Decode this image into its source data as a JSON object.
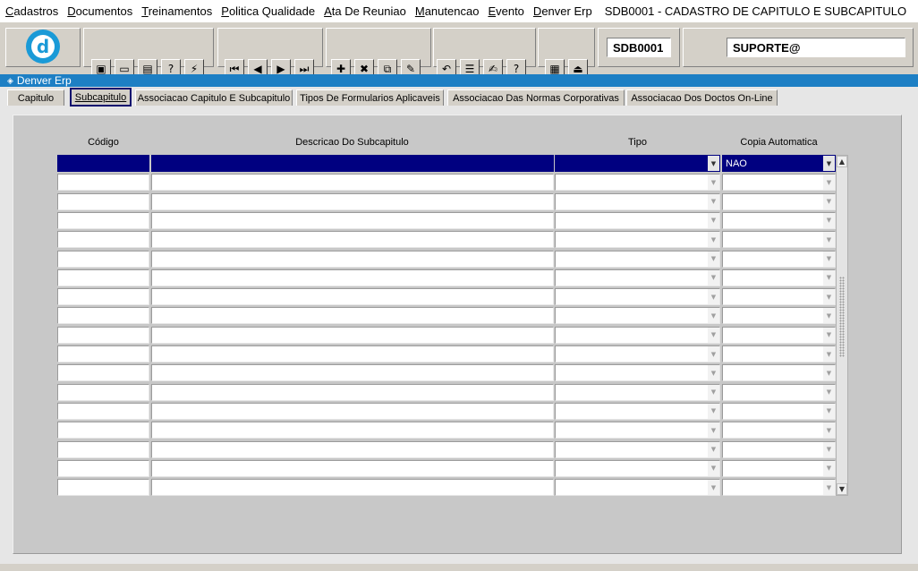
{
  "menu": {
    "items": [
      {
        "label": "Cadastros",
        "key": "C",
        "rest": "adastros"
      },
      {
        "label": "Documentos",
        "key": "D",
        "rest": "ocumentos"
      },
      {
        "label": "Treinamentos",
        "key": "T",
        "rest": "reinamentos"
      },
      {
        "label": "Politica Qualidade",
        "key": "P",
        "rest": "olitica Qualidade"
      },
      {
        "label": "Ata De Reuniao",
        "key": "A",
        "rest": "ta De Reuniao"
      },
      {
        "label": "Manutencao",
        "key": "M",
        "rest": "anutencao"
      },
      {
        "label": "Evento",
        "key": "E",
        "rest": "vento"
      },
      {
        "label": "Denver Erp",
        "key": "D",
        "rest": "enver Erp"
      }
    ],
    "window_title": "SDB0001 - CADASTRO DE CAPITULO E SUBCAPITULO"
  },
  "toolbar": {
    "logo_letter": "d",
    "form_code": "SDB0001",
    "user": "SUPORTE@",
    "buttons": [
      {
        "name": "save-button",
        "glyph": "▣"
      },
      {
        "name": "exit-form-button",
        "glyph": "▭"
      },
      {
        "name": "print-button",
        "glyph": "▤"
      },
      {
        "name": "enter-query-button",
        "glyph": "?"
      },
      {
        "name": "execute-query-button",
        "glyph": "⚡"
      },
      {
        "name": "first-record-button",
        "glyph": "⏮"
      },
      {
        "name": "previous-record-button",
        "glyph": "◀"
      },
      {
        "name": "next-record-button",
        "glyph": "▶"
      },
      {
        "name": "last-record-button",
        "glyph": "⏭"
      },
      {
        "name": "insert-record-button",
        "glyph": "✚"
      },
      {
        "name": "delete-record-button",
        "glyph": "✖"
      },
      {
        "name": "duplicate-record-button",
        "glyph": "⧉"
      },
      {
        "name": "clear-record-button",
        "glyph": "✎"
      },
      {
        "name": "undo-button",
        "glyph": "↶"
      },
      {
        "name": "list-values-button",
        "glyph": "☰"
      },
      {
        "name": "edit-field-button",
        "glyph": "✍"
      },
      {
        "name": "help-button",
        "glyph": "?"
      },
      {
        "name": "menu-button",
        "glyph": "▦"
      },
      {
        "name": "exit-button",
        "glyph": "⏏"
      }
    ]
  },
  "window": {
    "title": "Denver Erp"
  },
  "tabs": [
    {
      "label": "Capitulo",
      "active": false
    },
    {
      "label": "Subcapitulo",
      "active": true
    },
    {
      "label": "Associacao Capitulo E Subcapitulo",
      "active": false
    },
    {
      "label": "Tipos De Formularios Aplicaveis",
      "active": false
    },
    {
      "label": "Associacao Das Normas Corporativas",
      "active": false
    },
    {
      "label": "Associacao Dos Doctos On-Line",
      "active": false
    }
  ],
  "grid": {
    "headers": {
      "codigo": "Código",
      "descricao": "Descricao Do Subcapitulo",
      "tipo": "Tipo",
      "copia": "Copia Automatica"
    },
    "rows": [
      {
        "codigo": "",
        "descricao": "",
        "tipo": "",
        "copia": "NAO",
        "selected": true
      },
      {
        "codigo": "",
        "descricao": "",
        "tipo": "",
        "copia": ""
      },
      {
        "codigo": "",
        "descricao": "",
        "tipo": "",
        "copia": ""
      },
      {
        "codigo": "",
        "descricao": "",
        "tipo": "",
        "copia": ""
      },
      {
        "codigo": "",
        "descricao": "",
        "tipo": "",
        "copia": ""
      },
      {
        "codigo": "",
        "descricao": "",
        "tipo": "",
        "copia": ""
      },
      {
        "codigo": "",
        "descricao": "",
        "tipo": "",
        "copia": ""
      },
      {
        "codigo": "",
        "descricao": "",
        "tipo": "",
        "copia": ""
      },
      {
        "codigo": "",
        "descricao": "",
        "tipo": "",
        "copia": ""
      },
      {
        "codigo": "",
        "descricao": "",
        "tipo": "",
        "copia": ""
      },
      {
        "codigo": "",
        "descricao": "",
        "tipo": "",
        "copia": ""
      },
      {
        "codigo": "",
        "descricao": "",
        "tipo": "",
        "copia": ""
      },
      {
        "codigo": "",
        "descricao": "",
        "tipo": "",
        "copia": ""
      },
      {
        "codigo": "",
        "descricao": "",
        "tipo": "",
        "copia": ""
      },
      {
        "codigo": "",
        "descricao": "",
        "tipo": "",
        "copia": ""
      },
      {
        "codigo": "",
        "descricao": "",
        "tipo": "",
        "copia": ""
      },
      {
        "codigo": "",
        "descricao": "",
        "tipo": "",
        "copia": ""
      },
      {
        "codigo": "",
        "descricao": "",
        "tipo": "",
        "copia": ""
      }
    ]
  },
  "colors": {
    "selected_row": "#000080",
    "window_title_bar": "#1d7fc4",
    "logo": "#1a9ad7"
  }
}
